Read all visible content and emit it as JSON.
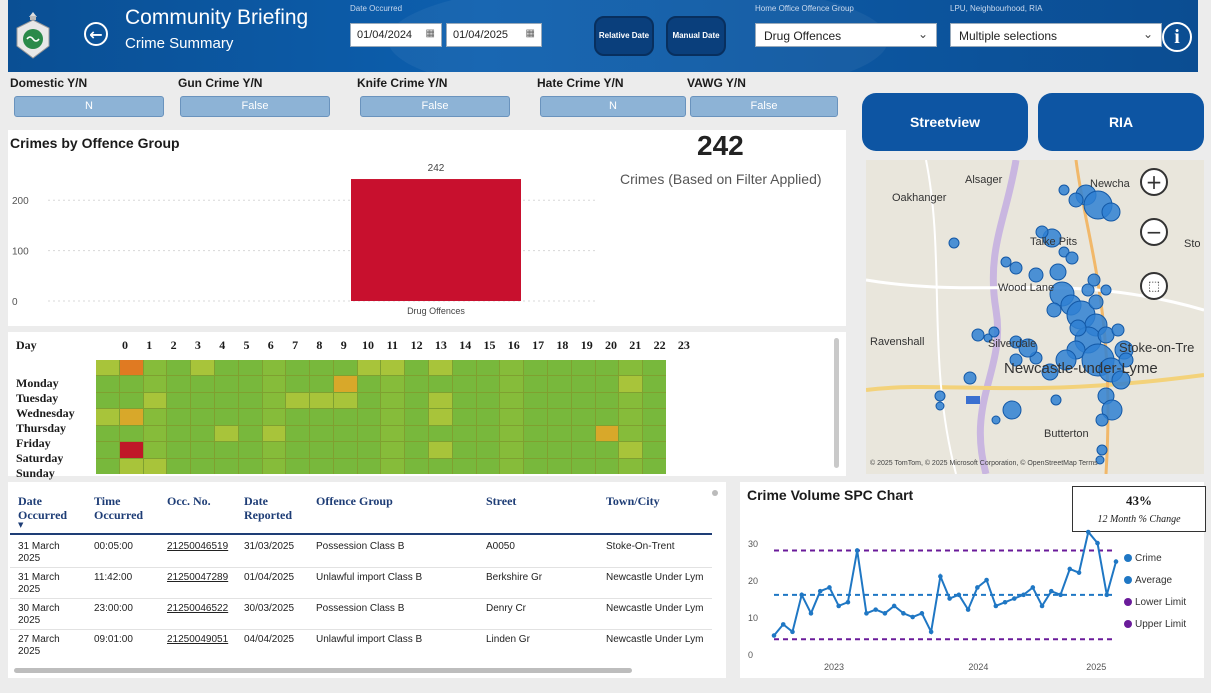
{
  "header": {
    "title": "Community Briefing",
    "subtitle": "Crime Summary",
    "date_label": "Date Occurred",
    "date_from": "01/04/2024",
    "date_to": "01/04/2025",
    "relative_btn": "Relative Date",
    "manual_btn": "Manual Date",
    "offence_label": "Home Office Offence Group",
    "offence_value": "Drug Offences",
    "area_label": "LPU, Neighbourhood, RIA",
    "area_value": "Multiple selections"
  },
  "filters": [
    {
      "label": "Domestic Y/N",
      "value": "N"
    },
    {
      "label": "Gun Crime Y/N",
      "value": "False"
    },
    {
      "label": "Knife Crime Y/N",
      "value": "False"
    },
    {
      "label": "Hate Crime Y/N",
      "value": "N"
    },
    {
      "label": "VAWG Y/N",
      "value": "False"
    }
  ],
  "actions": {
    "streetview": "Streetview",
    "ria": "RIA"
  },
  "summary": {
    "count": "242",
    "count_caption": "Crimes (Based on Filter Applied)"
  },
  "chart_data": [
    {
      "type": "bar",
      "title": "Crimes by Offence Group",
      "categories": [
        "Drug Offences"
      ],
      "values": [
        242
      ],
      "data_labels": [
        "242"
      ],
      "ylim": [
        0,
        250
      ],
      "yticks": [
        0,
        100,
        200
      ],
      "color": "#c8102e"
    },
    {
      "type": "line",
      "title": "Crime Volume SPC Chart",
      "xlabels": [
        "2023",
        "2024",
        "2025"
      ],
      "ylim": [
        0,
        33
      ],
      "yticks": [
        0,
        10,
        20,
        30
      ],
      "series": [
        {
          "name": "Crime",
          "values": [
            5,
            8,
            6,
            16,
            11,
            17,
            18,
            13,
            14,
            28,
            11,
            12,
            11,
            13,
            11,
            10,
            11,
            6,
            21,
            15,
            16,
            12,
            18,
            20,
            13,
            14,
            15,
            16,
            18,
            13,
            17,
            16,
            23,
            22,
            33,
            30,
            16,
            25
          ]
        },
        {
          "name": "Average",
          "values": [
            16,
            16
          ]
        },
        {
          "name": "Lower Limit",
          "values": [
            4,
            4
          ]
        },
        {
          "name": "Upper Limit",
          "values": [
            28,
            28
          ]
        }
      ],
      "kpi": {
        "value": "43%",
        "caption": "12 Month % Change"
      }
    }
  ],
  "heatmap": {
    "row_header": "Day",
    "hours": [
      "0",
      "1",
      "2",
      "3",
      "4",
      "5",
      "6",
      "7",
      "8",
      "9",
      "10",
      "11",
      "12",
      "13",
      "14",
      "15",
      "16",
      "17",
      "18",
      "19",
      "20",
      "21",
      "22",
      "23"
    ],
    "days": [
      "Monday",
      "Tuesday",
      "Wednesday",
      "Thursday",
      "Friday",
      "Saturday",
      "Sunday"
    ],
    "values": [
      [
        2,
        4,
        1,
        1,
        2,
        1,
        1,
        1,
        1,
        1,
        1,
        2,
        2,
        1,
        2,
        1,
        1,
        1,
        1,
        1,
        1,
        1,
        1,
        1
      ],
      [
        1,
        1,
        1,
        1,
        1,
        1,
        1,
        1,
        1,
        1,
        3,
        1,
        1,
        1,
        1,
        1,
        1,
        1,
        1,
        1,
        1,
        1,
        2,
        1
      ],
      [
        1,
        1,
        2,
        1,
        1,
        1,
        1,
        1,
        2,
        2,
        2,
        1,
        1,
        1,
        2,
        1,
        1,
        1,
        1,
        1,
        1,
        1,
        1,
        1
      ],
      [
        2,
        3,
        1,
        1,
        1,
        1,
        1,
        1,
        1,
        1,
        1,
        1,
        1,
        1,
        2,
        1,
        1,
        1,
        1,
        1,
        1,
        1,
        1,
        1
      ],
      [
        1,
        1,
        1,
        1,
        1,
        2,
        1,
        2,
        1,
        1,
        1,
        1,
        1,
        1,
        1,
        1,
        1,
        1,
        1,
        1,
        1,
        3,
        1,
        1
      ],
      [
        1,
        5,
        1,
        1,
        1,
        1,
        1,
        1,
        1,
        1,
        1,
        1,
        1,
        1,
        2,
        1,
        1,
        1,
        1,
        1,
        1,
        1,
        2,
        1
      ],
      [
        1,
        2,
        2,
        1,
        1,
        1,
        1,
        1,
        1,
        1,
        1,
        1,
        1,
        1,
        1,
        1,
        1,
        1,
        1,
        1,
        1,
        1,
        1,
        1
      ]
    ]
  },
  "table": {
    "columns": [
      "Date Occurred",
      "Time Occurred",
      "Occ. No.",
      "Date Reported",
      "Offence Group",
      "Street",
      "Town/City"
    ],
    "rows": [
      {
        "date": "31 March 2025",
        "time": "00:05:00",
        "occ": "21250046519",
        "reported": "31/03/2025",
        "group": "Possession Class B",
        "street": "A0050",
        "town": "Stoke-On-Trent"
      },
      {
        "date": "31 March 2025",
        "time": "11:42:00",
        "occ": "21250047289",
        "reported": "01/04/2025",
        "group": "Unlawful import Class B",
        "street": "Berkshire Gr",
        "town": "Newcastle Under Lym"
      },
      {
        "date": "30 March 2025",
        "time": "23:00:00",
        "occ": "21250046522",
        "reported": "30/03/2025",
        "group": "Possession Class B",
        "street": "Denry Cr",
        "town": "Newcastle Under Lym"
      },
      {
        "date": "27 March 2025",
        "time": "09:01:00",
        "occ": "21250049051",
        "reported": "04/04/2025",
        "group": "Unlawful import Class B",
        "street": "Linden Gr",
        "town": "Newcastle Under Lym"
      }
    ]
  },
  "map": {
    "places": [
      "Alsager",
      "Newcha",
      "Oakhanger",
      "Talke Pits",
      "Wood Lane",
      "Ravenshall",
      "Silverdale",
      "Stoke-on-Tre",
      "Newcastle-under-Lyme",
      "Butterton",
      "Sto"
    ],
    "attribution": "© 2025 TomTom, © 2025 Microsoft Corporation, © OpenStreetMap  Terms"
  },
  "colors": {
    "brand": "#0d55a3",
    "bar": "#c8102e",
    "series": "#1f77c4",
    "limit": "#6a1b9a"
  }
}
